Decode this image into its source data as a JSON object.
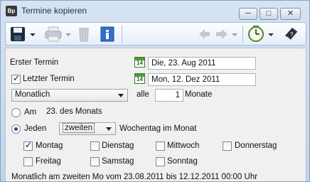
{
  "window": {
    "title": "Termine kopieren",
    "app_icon_text": "Bp"
  },
  "toolbar": {
    "items": [
      "save-icon",
      "print-icon",
      "delete-icon",
      "info-icon",
      "back-arrow-icon",
      "forward-arrow-icon",
      "clock-icon",
      "help-book-icon"
    ]
  },
  "form": {
    "first_date_label": "Erster Termin",
    "first_date_value": "Die, 23. Aug 2011",
    "last_date_label": "Letzter Termin",
    "last_date_checked": true,
    "last_date_value": "Mon, 12. Dez 2011",
    "calendar_icon_number": "14",
    "interval_select": "Monatlich",
    "every_label": "alle",
    "every_value": "1",
    "every_unit": "Monate",
    "mode_am_label": "Am",
    "mode_am_text": "23. des Monats",
    "mode_am_selected": false,
    "mode_jeden_label": "Jeden",
    "mode_jeden_selected": true,
    "ordinal_select": "zweiten",
    "weekday_suffix": "Wochentag im Monat",
    "weekdays": [
      {
        "label": "Montag",
        "checked": true
      },
      {
        "label": "Dienstag",
        "checked": false
      },
      {
        "label": "Mittwoch",
        "checked": false
      },
      {
        "label": "Donnerstag",
        "checked": false
      },
      {
        "label": "Freitag",
        "checked": false
      },
      {
        "label": "Samstag",
        "checked": false
      },
      {
        "label": "Sonntag",
        "checked": false
      }
    ],
    "summary": "Monatlich am zweiten Mo vom 23.08.2011 bis 12.12.2011 00:00 Uhr"
  }
}
